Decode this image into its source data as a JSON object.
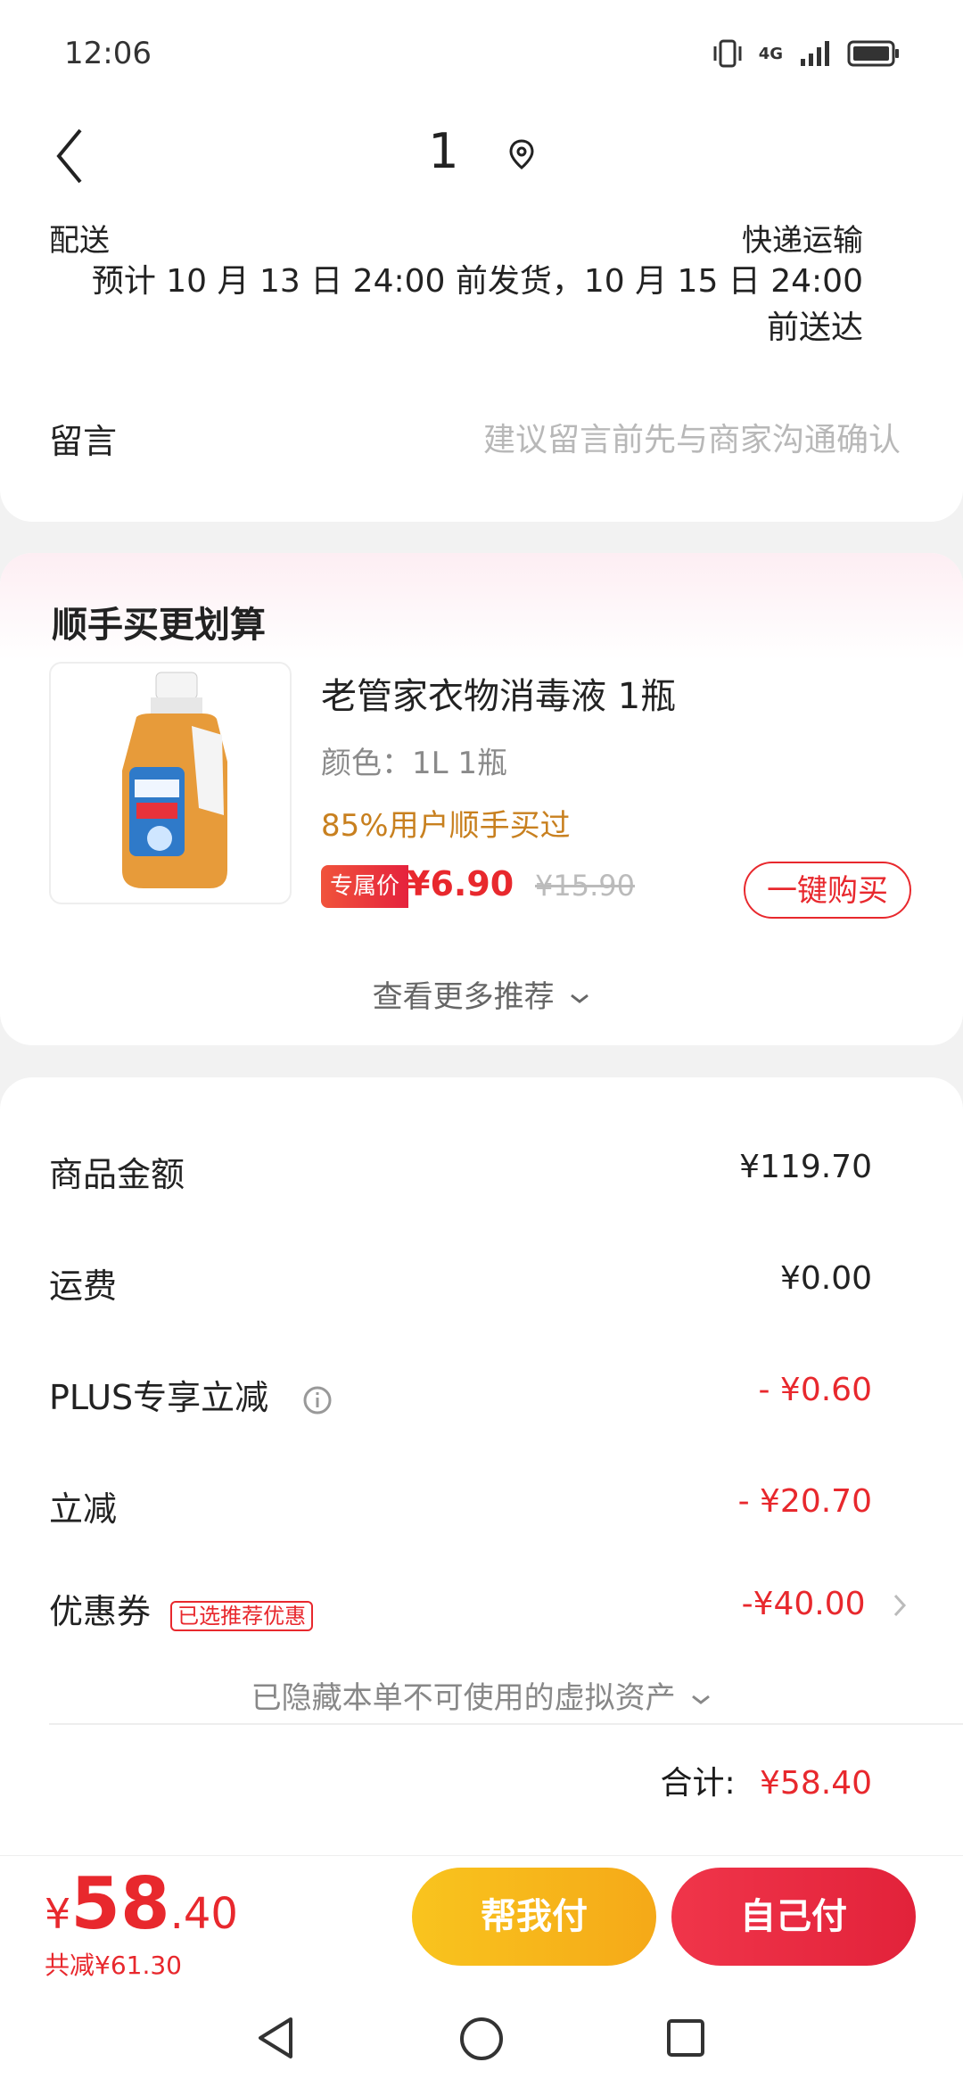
{
  "status_bar": {
    "time": "12:06",
    "network": "4G"
  },
  "header": {
    "title": "1"
  },
  "delivery": {
    "label": "配送",
    "method": "快递运输",
    "line1": "预计 10 月 13 日 24:00 前发货，10 月 15 日 24:00",
    "line2": "前送达"
  },
  "note": {
    "label": "留言",
    "placeholder": "建议留言前先与商家沟通确认"
  },
  "recommend": {
    "title": "顺手买更划算",
    "product": {
      "name": "老管家衣物消毒液 1瓶",
      "spec": "颜色：1L 1瓶",
      "social": "85%用户顺手买过",
      "tag": "专属价",
      "price": "¥6.90",
      "original_price": "¥15.90",
      "buy_label": "一键购买"
    },
    "more_label": "查看更多推荐"
  },
  "summary": {
    "rows": [
      {
        "label": "商品金额",
        "value": "¥119.70"
      },
      {
        "label": "运费",
        "value": "¥0.00"
      },
      {
        "label": "PLUS专享立减",
        "value": "- ¥0.60"
      },
      {
        "label": "立减",
        "value": "- ¥20.70"
      },
      {
        "label": "优惠券",
        "tag": "已选推荐优惠",
        "value": "-¥40.00"
      }
    ],
    "hidden_note": "已隐藏本单不可使用的虚拟资产",
    "total_label": "合计:",
    "total_value": "¥58.40"
  },
  "bottom": {
    "currency": "¥",
    "price_int": "58",
    "price_dec": ".40",
    "saved": "共减¥61.30",
    "help_pay_label": "帮我付",
    "self_pay_label": "自己付"
  },
  "colors": {
    "accent_red": "#e8282d",
    "help_pay": "#f7b41c"
  }
}
